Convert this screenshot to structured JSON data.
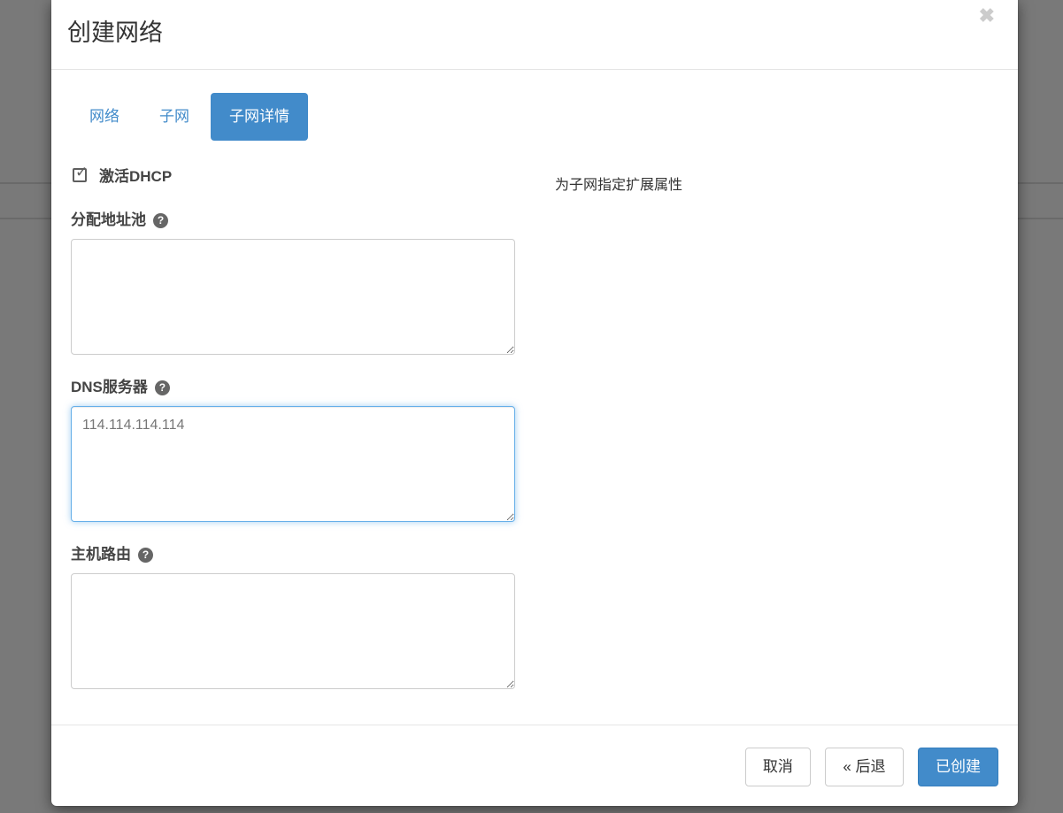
{
  "modal": {
    "title": "创建网络",
    "close_glyph": "✖",
    "tabs": [
      {
        "label": "网络",
        "active": false
      },
      {
        "label": "子网",
        "active": false
      },
      {
        "label": "子网详情",
        "active": true
      }
    ],
    "form": {
      "dhcp": {
        "label": "激活DHCP",
        "checked": true,
        "check_glyph": "✓"
      },
      "help_glyph": "?",
      "description": "为子网指定扩展属性",
      "fields": [
        {
          "label": "分配地址池",
          "value": "",
          "focused": false
        },
        {
          "label": "DNS服务器",
          "value": "114.114.114.114",
          "focused": true
        },
        {
          "label": "主机路由",
          "value": "",
          "focused": false
        }
      ]
    },
    "footer": {
      "cancel_label": "取消",
      "back_label": "« 后退",
      "submit_label": "已创建"
    }
  },
  "colors": {
    "accent": "#428bca",
    "primary_button_border": "#357ebd",
    "focus_border": "#66afe9",
    "backdrop": "#797979",
    "divider": "#e5e5e5"
  }
}
